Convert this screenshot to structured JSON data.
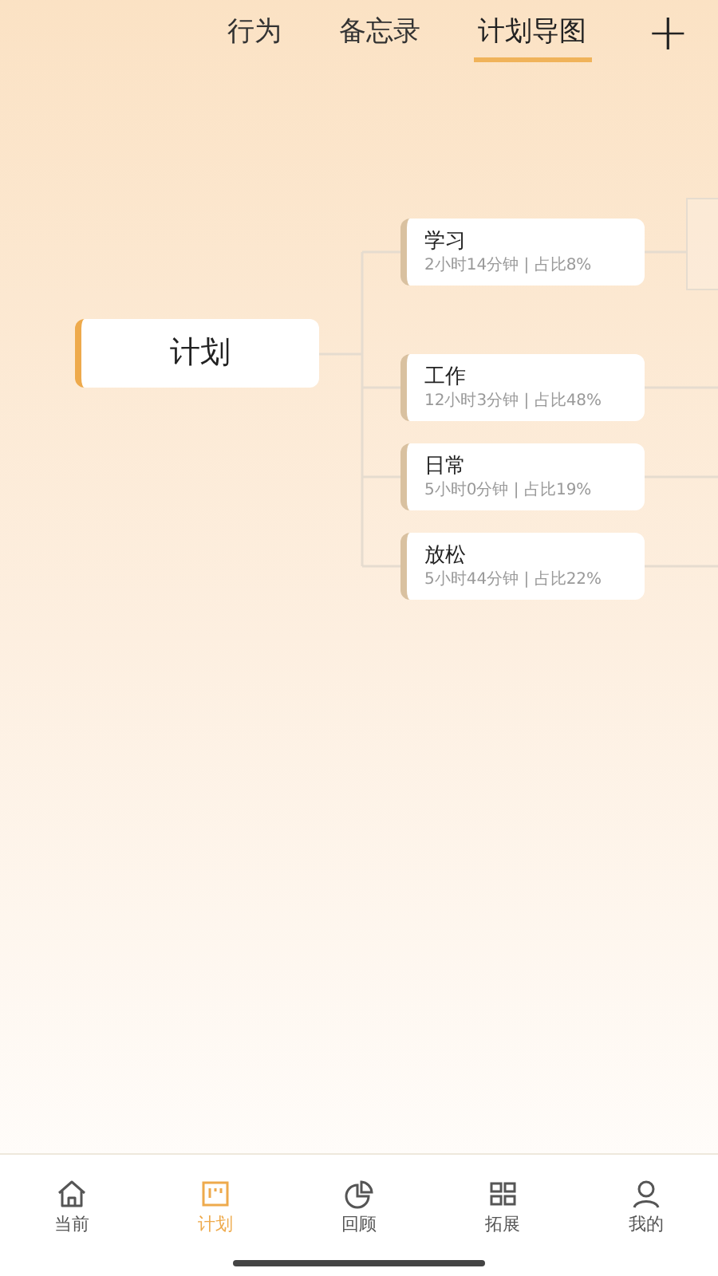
{
  "tabs": [
    {
      "label": "行为",
      "selected": false
    },
    {
      "label": "备忘录",
      "selected": false
    },
    {
      "label": "计划导图",
      "selected": true
    }
  ],
  "add_button": "+",
  "mind_map": {
    "root": "计划",
    "children": [
      {
        "title": "学习",
        "detail": "2小时14分钟 | 占比8%",
        "children": [
          {
            "kind": "node"
          }
        ]
      },
      {
        "title": "工作",
        "detail": "12小时3分钟 | 占比48%"
      },
      {
        "title": "日常",
        "detail": "5小时0分钟 | 占比19%"
      },
      {
        "title": "放松",
        "detail": "5小时44分钟 | 占比22%"
      }
    ]
  },
  "bottom_nav": [
    {
      "label": "当前",
      "kind": "home",
      "selected": false
    },
    {
      "label": "计划",
      "kind": "board",
      "selected": true
    },
    {
      "label": "回顾",
      "kind": "pie",
      "selected": false
    },
    {
      "label": "拓展",
      "kind": "grid",
      "selected": false
    },
    {
      "label": "我的",
      "kind": "user",
      "selected": false
    }
  ]
}
